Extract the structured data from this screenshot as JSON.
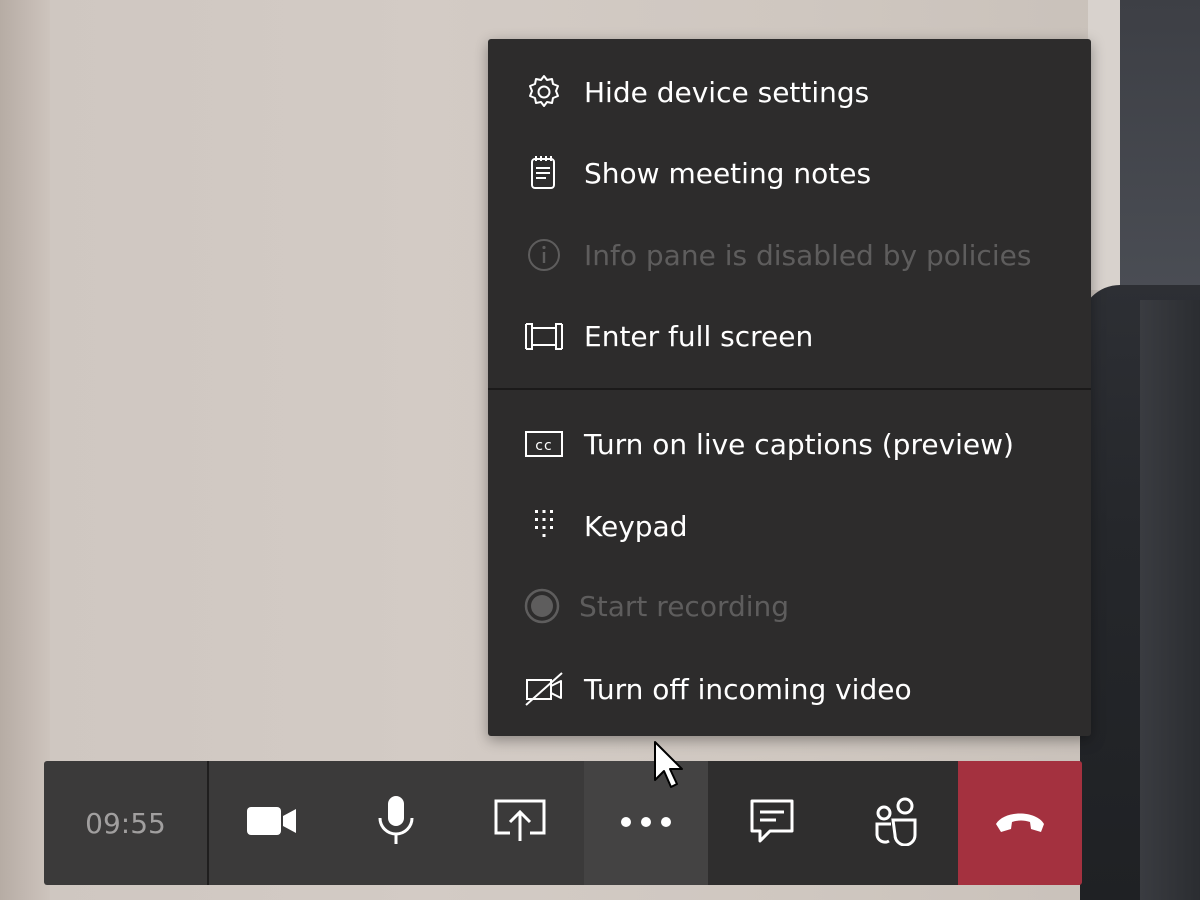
{
  "menu": {
    "items": [
      {
        "label": "Hide device settings",
        "icon": "gear-icon",
        "enabled": true
      },
      {
        "label": "Show meeting notes",
        "icon": "notes-icon",
        "enabled": true
      },
      {
        "label": "Info pane is disabled by policies",
        "icon": "info-icon",
        "enabled": false
      },
      {
        "label": "Enter full screen",
        "icon": "fullscreen-icon",
        "enabled": true
      },
      {
        "label": "Turn on live captions (preview)",
        "icon": "captions-icon",
        "enabled": true
      },
      {
        "label": "Keypad",
        "icon": "keypad-icon",
        "enabled": true
      },
      {
        "label": "Start recording",
        "icon": "record-icon",
        "enabled": false
      },
      {
        "label": "Turn off incoming video",
        "icon": "video-off-icon",
        "enabled": true
      }
    ]
  },
  "toolbar": {
    "timer": "09:55",
    "buttons": [
      {
        "name": "camera-button",
        "icon": "video-camera-icon"
      },
      {
        "name": "microphone-button",
        "icon": "microphone-icon"
      },
      {
        "name": "share-screen-button",
        "icon": "share-screen-icon"
      },
      {
        "name": "more-actions-button",
        "icon": "more-dots-icon"
      },
      {
        "name": "chat-button",
        "icon": "chat-icon"
      },
      {
        "name": "participants-button",
        "icon": "participants-icon"
      },
      {
        "name": "hang-up-button",
        "icon": "hang-up-icon"
      }
    ]
  },
  "colors": {
    "menu_bg": "#2d2c2c",
    "toolbar_bg": "#3b3a3a",
    "hangup_red": "#a4313f",
    "disabled_text": "#5e5d5d",
    "text": "#ffffff"
  }
}
